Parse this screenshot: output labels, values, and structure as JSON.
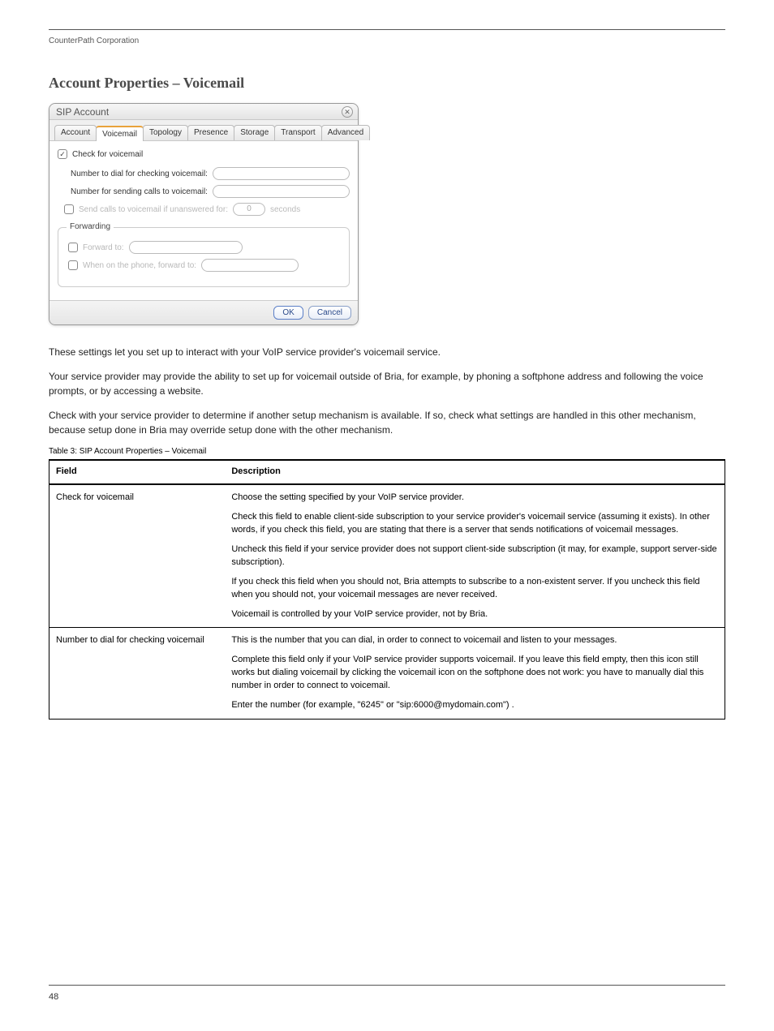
{
  "header": {
    "left_text": "CounterPath Corporation",
    "right_text": ""
  },
  "dialog": {
    "title": "SIP Account",
    "close_icon": "close",
    "tabs": [
      "Account",
      "Voicemail",
      "Topology",
      "Presence",
      "Storage",
      "Transport",
      "Advanced"
    ],
    "active_tab_index": 1,
    "check_voicemail": {
      "checked": true,
      "label": "Check for voicemail"
    },
    "number_dial_label": "Number to dial for checking voicemail:",
    "number_send_label": "Number for sending calls to voicemail:",
    "send_unanswered": {
      "checked": false,
      "label": "Send calls to voicemail if unanswered for:",
      "value": "0",
      "unit": "seconds"
    },
    "forwarding": {
      "legend": "Forwarding",
      "forward_to": {
        "checked": false,
        "label": "Forward to:"
      },
      "busy_forward": {
        "checked": false,
        "label": "When on the phone, forward to:"
      }
    },
    "buttons": {
      "ok": "OK",
      "cancel": "Cancel"
    }
  },
  "paras": {
    "p1": "These settings let you set up to interact with your VoIP service provider's voicemail service.",
    "p2": "Your service provider may provide the ability to set up for voicemail outside of Bria, for example, by phoning a softphone address and following the voice prompts, or by accessing a website.",
    "p3": "Check with your service provider to determine if another setup mechanism is available. If so, check what settings are handled in this other mechanism, because setup done in Bria may override setup done with the other mechanism."
  },
  "table": {
    "caption": "Table 3: SIP Account Properties – Voicemail",
    "headers": [
      "Field",
      "Description"
    ],
    "rows": [
      {
        "field": "Check for voicemail",
        "desc": [
          "Choose the setting specified by your VoIP service provider.",
          "Check this field to enable client-side subscription to your service provider's voicemail service (assuming it exists). In other words, if you check this field, you are stating that there is a server that sends notifications of voicemail messages.",
          "Uncheck this field if your service provider does not support client-side subscription (it may, for example, support server-side subscription).",
          "If you check this field when you should not, Bria attempts to subscribe to a non-existent server. If you uncheck this field when you should not, your voicemail messages are never received.",
          "Voicemail is controlled by your VoIP service provider, not by Bria."
        ]
      },
      {
        "field": "Number to dial for checking voicemail",
        "desc": [
          "This is the number that you can dial, in order to connect to voicemail and listen to your messages.",
          "Complete this field only if your VoIP service provider supports voicemail. If you leave this field empty, then this icon still works but dialing voicemail by clicking the voicemail icon on the softphone does not work: you have to manually dial this number in order to connect to voicemail.",
          "Enter the number (for example, \"6245\" or \"sip:6000@mydomain.com\") ."
        ]
      }
    ]
  },
  "section_title": "Account Properties – Voicemail",
  "footer": {
    "page_number": "48"
  }
}
